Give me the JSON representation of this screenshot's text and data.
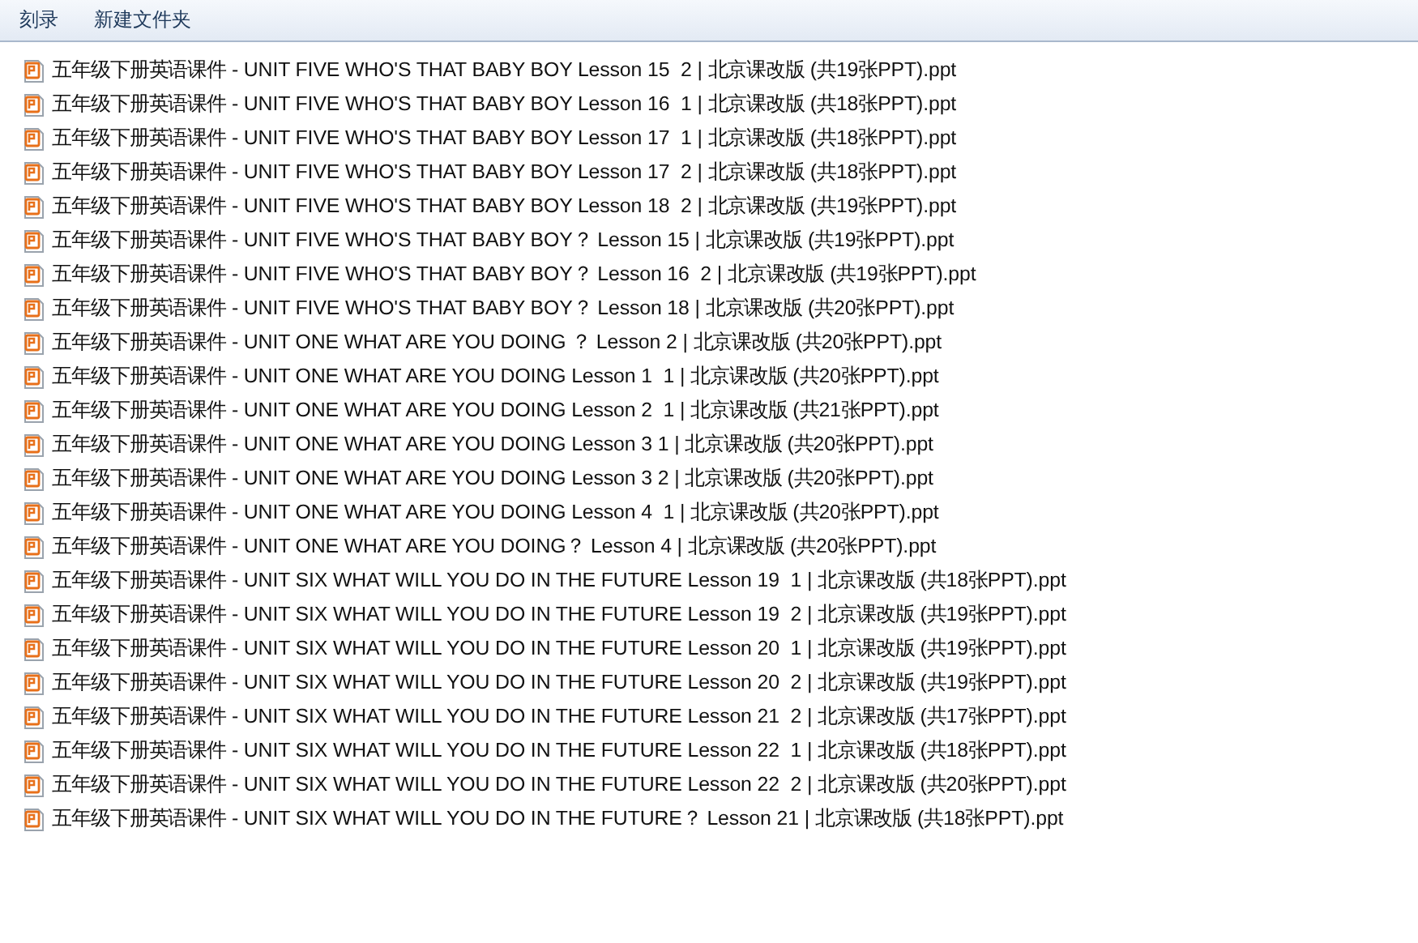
{
  "toolbar": {
    "buttons": [
      "刻录",
      "新建文件夹"
    ]
  },
  "files": [
    {
      "name": "五年级下册英语课件 - UNIT FIVE WHO'S THAT BABY BOY Lesson 15  2 | 北京课改版 (共19张PPT).ppt"
    },
    {
      "name": "五年级下册英语课件 - UNIT FIVE WHO'S THAT BABY BOY Lesson 16  1 | 北京课改版 (共18张PPT).ppt"
    },
    {
      "name": "五年级下册英语课件 - UNIT FIVE WHO'S THAT BABY BOY Lesson 17  1 | 北京课改版 (共18张PPT).ppt"
    },
    {
      "name": "五年级下册英语课件 - UNIT FIVE WHO'S THAT BABY BOY Lesson 17  2 | 北京课改版 (共18张PPT).ppt"
    },
    {
      "name": "五年级下册英语课件 - UNIT FIVE WHO'S THAT BABY BOY Lesson 18  2 | 北京课改版 (共19张PPT).ppt"
    },
    {
      "name": "五年级下册英语课件 - UNIT FIVE WHO'S THAT BABY BOY？ Lesson 15 | 北京课改版 (共19张PPT).ppt"
    },
    {
      "name": "五年级下册英语课件 - UNIT FIVE WHO'S THAT BABY BOY？ Lesson 16  2 | 北京课改版 (共19张PPT).ppt"
    },
    {
      "name": "五年级下册英语课件 - UNIT FIVE WHO'S THAT BABY BOY？ Lesson 18 | 北京课改版 (共20张PPT).ppt"
    },
    {
      "name": "五年级下册英语课件 - UNIT ONE WHAT ARE YOU DOING ？ Lesson 2 | 北京课改版 (共20张PPT).ppt"
    },
    {
      "name": "五年级下册英语课件 - UNIT ONE WHAT ARE YOU DOING Lesson 1  1 | 北京课改版 (共20张PPT).ppt"
    },
    {
      "name": "五年级下册英语课件 - UNIT ONE WHAT ARE YOU DOING Lesson 2  1 | 北京课改版 (共21张PPT).ppt"
    },
    {
      "name": "五年级下册英语课件 - UNIT ONE WHAT ARE YOU DOING Lesson 3 1 | 北京课改版 (共20张PPT).ppt"
    },
    {
      "name": "五年级下册英语课件 - UNIT ONE WHAT ARE YOU DOING Lesson 3 2 | 北京课改版 (共20张PPT).ppt"
    },
    {
      "name": "五年级下册英语课件 - UNIT ONE WHAT ARE YOU DOING Lesson 4  1 | 北京课改版 (共20张PPT).ppt"
    },
    {
      "name": "五年级下册英语课件 - UNIT ONE WHAT ARE YOU DOING？ Lesson 4 | 北京课改版 (共20张PPT).ppt"
    },
    {
      "name": "五年级下册英语课件 - UNIT SIX WHAT WILL YOU DO IN THE FUTURE Lesson 19  1 | 北京课改版 (共18张PPT).ppt"
    },
    {
      "name": "五年级下册英语课件 - UNIT SIX WHAT WILL YOU DO IN THE FUTURE Lesson 19  2 | 北京课改版 (共19张PPT).ppt"
    },
    {
      "name": "五年级下册英语课件 - UNIT SIX WHAT WILL YOU DO IN THE FUTURE Lesson 20  1 | 北京课改版 (共19张PPT).ppt"
    },
    {
      "name": "五年级下册英语课件 - UNIT SIX WHAT WILL YOU DO IN THE FUTURE Lesson 20  2 | 北京课改版 (共19张PPT).ppt"
    },
    {
      "name": "五年级下册英语课件 - UNIT SIX WHAT WILL YOU DO IN THE FUTURE Lesson 21  2 | 北京课改版 (共17张PPT).ppt"
    },
    {
      "name": "五年级下册英语课件 - UNIT SIX WHAT WILL YOU DO IN THE FUTURE Lesson 22  1 | 北京课改版 (共18张PPT).ppt"
    },
    {
      "name": "五年级下册英语课件 - UNIT SIX WHAT WILL YOU DO IN THE FUTURE Lesson 22  2 | 北京课改版 (共20张PPT).ppt"
    },
    {
      "name": "五年级下册英语课件 - UNIT SIX WHAT WILL YOU DO IN THE FUTURE？ Lesson 21 | 北京课改版 (共18张PPT).ppt"
    }
  ]
}
